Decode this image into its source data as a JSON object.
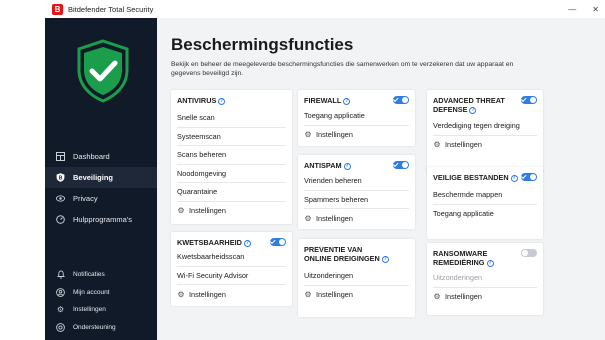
{
  "window": {
    "title": "Bitdefender Total Security",
    "logo_letter": "B",
    "minimize_symbol": "—",
    "close_symbol": "✕"
  },
  "sidebar": {
    "items": [
      {
        "label": "Dashboard",
        "icon": "dashboard-icon"
      },
      {
        "label": "Beveiliging",
        "icon": "shield-b-icon"
      },
      {
        "label": "Privacy",
        "icon": "eye-icon"
      },
      {
        "label": "Hulpprogramma's",
        "icon": "gauge-icon"
      }
    ],
    "bottom_items": [
      {
        "label": "Notificaties",
        "icon": "bell-icon"
      },
      {
        "label": "Mijn account",
        "icon": "user-icon"
      },
      {
        "label": "Instellingen",
        "icon": "gear-icon"
      },
      {
        "label": "Ondersteuning",
        "icon": "support-icon"
      }
    ]
  },
  "main": {
    "title": "Beschermingsfuncties",
    "description": "Bekijk en beheer de meegeleverde beschermingsfuncties die samenwerken om te verzekeren dat uw apparaat en gegevens beveiligd zijn.",
    "settings_label": "Instellingen",
    "cards": {
      "antivirus": {
        "title": "ANTIVIRUS",
        "items": [
          "Snelle scan",
          "Systeemscan",
          "Scans beheren",
          "Noodomgeving",
          "Quarantaine"
        ]
      },
      "kwetsbaarheid": {
        "title": "KWETSBAARHEID",
        "toggle": "on",
        "items": [
          "Kwetsbaarheidsscan",
          "Wi-Fi Security Advisor"
        ]
      },
      "firewall": {
        "title": "FIREWALL",
        "toggle": "on",
        "items": [
          "Toegang applicatie"
        ]
      },
      "antispam": {
        "title": "ANTISPAM",
        "toggle": "on",
        "items": [
          "Vrienden beheren",
          "Spammers beheren"
        ]
      },
      "preventie": {
        "title_line1": "PREVENTIE VAN",
        "title_line2": "ONLINE DREIGINGEN",
        "items": [
          "Uitzonderingen"
        ]
      },
      "threat_defense": {
        "title_line1": "ADVANCED THREAT",
        "title_line2": "DEFENSE",
        "toggle": "on",
        "items": [
          "Verdediging tegen dreiging"
        ]
      },
      "veilige_bestanden": {
        "title": "VEILIGE BESTANDEN",
        "toggle": "on",
        "items": [
          "Beschermde mappen",
          "Toegang applicatie"
        ]
      },
      "ransomware": {
        "title_line1": "RANSOMWARE",
        "title_line2": "REMEDIËRING",
        "toggle": "off",
        "items": [
          "Uitzonderingen"
        ]
      }
    }
  },
  "colors": {
    "brand_red": "#e1151a",
    "sidebar_bg": "#111a29",
    "shield_green": "#1a9e4b",
    "accent_blue": "#2f7de1"
  }
}
